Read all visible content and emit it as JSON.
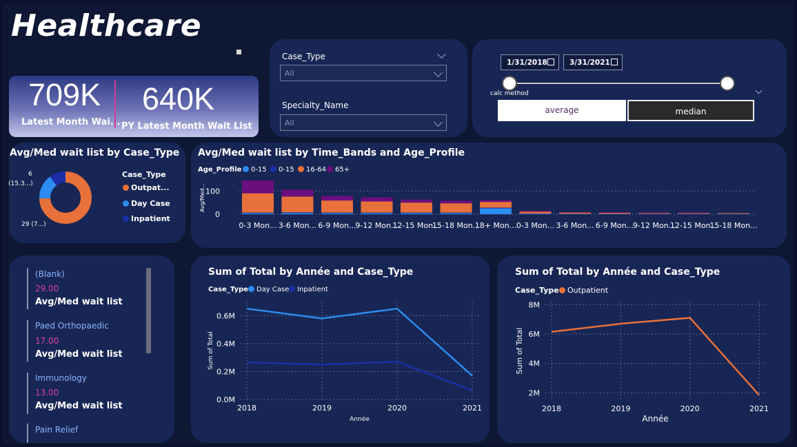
{
  "title": "Healthcare",
  "kpi": {
    "latest_value": "709K",
    "latest_label": "Latest Month Wai...",
    "py_value": "640K",
    "py_label": "PY Latest Month Wait List"
  },
  "filters": {
    "case_type_label": "Case_Type",
    "case_type_value": "All",
    "specialty_label": "Specialty_Name",
    "specialty_value": "All"
  },
  "date_range": {
    "start": "1/31/2018",
    "end": "3/31/2021",
    "calc_label": "calc method"
  },
  "calc_buttons": {
    "average": "average",
    "median": "median",
    "selected": "average"
  },
  "donut": {
    "title": "Avg/Med wait list by Case_Type",
    "legend_title": "Case_Type",
    "labels": {
      "top": "6",
      "top2": "(15.3...)",
      "bottom": "29 (7...)"
    },
    "chart_data": {
      "type": "pie",
      "series": [
        {
          "name": "Outpat...",
          "value": 29,
          "color": "#e8703a"
        },
        {
          "name": "Day Case",
          "value": 6,
          "color": "#2d8cf0"
        },
        {
          "name": "Inpatient",
          "value": 4,
          "color": "#1b2ea8"
        }
      ]
    }
  },
  "stacked": {
    "title": "Avg/Med wait list by Time_Bands and Age_Profile",
    "legend_title": "Age_Profile",
    "y_label": "Avg/Med...",
    "chart_data": {
      "type": "bar",
      "categories": [
        "0-3 Mon...",
        "3-6 Mon...",
        "6-9 Mon...",
        "9-12 Mon...",
        "12-15 Mon...",
        "15-18 Mon...",
        "18+ Mon...",
        "0-3 Mon...",
        "3-6 Mon...",
        "6-9 Mon...",
        "9-12 Mon...",
        "12-15 Mon...",
        "15-18 Mon..."
      ],
      "y_ticks": [
        0,
        100
      ],
      "ylim": [
        0,
        160
      ],
      "series": [
        {
          "name": "0-15",
          "color": "#2d8cf0",
          "values": [
            4,
            5,
            4,
            4,
            4,
            4,
            25,
            2,
            1,
            1,
            1,
            1,
            1
          ]
        },
        {
          "name": "0-15",
          "color": "#1b2ea8",
          "values": [
            3,
            3,
            3,
            3,
            3,
            3,
            3,
            1,
            1,
            1,
            1,
            1,
            1
          ]
        },
        {
          "name": "16-64",
          "color": "#e8703a",
          "values": [
            83,
            68,
            52,
            48,
            43,
            40,
            25,
            8,
            5,
            4,
            3,
            3,
            3
          ]
        },
        {
          "name": "65+",
          "color": "#6b0f7e",
          "values": [
            55,
            30,
            20,
            17,
            13,
            11,
            8,
            4,
            2,
            2,
            2,
            2,
            1
          ]
        }
      ]
    }
  },
  "cards": [
    {
      "name": "(Blank)",
      "value": "29.00",
      "label": "Avg/Med wait list"
    },
    {
      "name": "Paed Orthopaedic",
      "value": "17.00",
      "label": "Avg/Med wait list"
    },
    {
      "name": "Immunology",
      "value": "13.00",
      "label": "Avg/Med wait list"
    },
    {
      "name": "Pain Relief",
      "value": "",
      "label": ""
    }
  ],
  "line1": {
    "title": "Sum of Total by Année and Case_Type",
    "legend_title": "Case_Type",
    "chart_data": {
      "type": "line",
      "x": [
        2018,
        2019,
        2020,
        2021
      ],
      "xlabel": "Année",
      "ylabel": "Sum of Total",
      "y_ticks": [
        "0.0M",
        "0.2M",
        "0.4M",
        "0.6M"
      ],
      "ylim": [
        0,
        0.7
      ],
      "series": [
        {
          "name": "Day Case",
          "color": "#2d8cf0",
          "values": [
            0.65,
            0.58,
            0.65,
            0.17
          ]
        },
        {
          "name": "Inpatient",
          "color": "#1b2ea8",
          "values": [
            0.265,
            0.25,
            0.27,
            0.065
          ]
        }
      ]
    }
  },
  "line2": {
    "title": "Sum of Total by Année and Case_Type",
    "legend_title": "Case_Type",
    "chart_data": {
      "type": "line",
      "x": [
        2018,
        2019,
        2020,
        2021
      ],
      "xlabel": "Année",
      "ylabel": "Sum of Total",
      "y_ticks": [
        "2M",
        "4M",
        "6M",
        "8M"
      ],
      "ylim": [
        1.5,
        8.2
      ],
      "series": [
        {
          "name": "Outpatient",
          "color": "#e8703a",
          "values": [
            6.15,
            6.7,
            7.1,
            1.85
          ]
        }
      ]
    }
  }
}
